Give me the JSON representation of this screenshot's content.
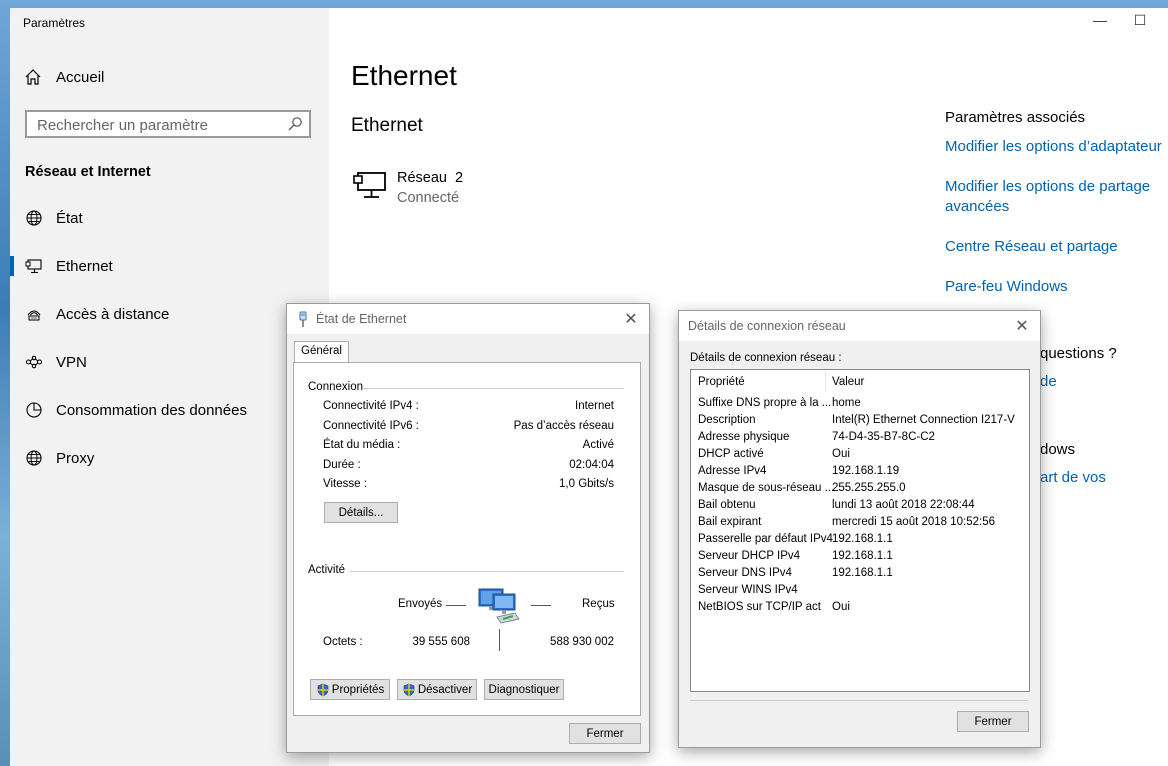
{
  "settings": {
    "window_title": "Paramètres",
    "minimize": "—",
    "maximize": "☐",
    "home_label": "Accueil",
    "search_placeholder": "Rechercher un paramètre",
    "section": "Réseau et Internet",
    "nav": [
      {
        "label": "État",
        "icon": "globe-icon"
      },
      {
        "label": "Ethernet",
        "icon": "ethernet-icon"
      },
      {
        "label": "Accès à distance",
        "icon": "dialup-icon"
      },
      {
        "label": "VPN",
        "icon": "vpn-icon"
      },
      {
        "label": "Consommation des données",
        "icon": "data-usage-icon"
      },
      {
        "label": "Proxy",
        "icon": "globe-icon"
      }
    ],
    "page_title": "Ethernet",
    "sub_title": "Ethernet",
    "network_name": "Réseau  2",
    "network_status": "Connecté",
    "related_title": "Paramètres associés",
    "related_links": [
      "Modifier les options d’adaptateur",
      "Modifier les options de partage avancées",
      "Centre Réseau et partage",
      "Pare-feu Windows"
    ],
    "peek_questions": "questions ?",
    "peek_de": "de",
    "peek_dows": "dows",
    "peek_art": "art de vos",
    "accent": "#0063b1"
  },
  "etat": {
    "title": "État de Ethernet",
    "tab": "Général",
    "connexion_label": "Connexion",
    "rows": [
      {
        "key": "Connectivité IPv4 :",
        "value": "Internet"
      },
      {
        "key": "Connectivité IPv6 :",
        "value": "Pas d’accès réseau"
      },
      {
        "key": "État du média :",
        "value": "Activé"
      },
      {
        "key": "Durée :",
        "value": "02:04:04"
      },
      {
        "key": "Vitesse :",
        "value": "1,0 Gbits/s"
      }
    ],
    "details_button": "Détails...",
    "activite_label": "Activité",
    "envoyes": "Envoyés",
    "recus": "Reçus",
    "octets_label": "Octets :",
    "octets_sent": "39 555 608",
    "octets_recv": "588 930 002",
    "btn_proprietes": "Propriétés",
    "btn_desactiver": "Désactiver",
    "btn_diagnostiquer": "Diagnostiquer",
    "btn_fermer": "Fermer"
  },
  "details": {
    "title": "Détails de connexion réseau",
    "label": "Détails de connexion réseau :",
    "col_prop": "Propriété",
    "col_val": "Valeur",
    "rows": [
      {
        "prop": "Suffixe DNS propre à la ...",
        "val": "home"
      },
      {
        "prop": "Description",
        "val": "Intel(R) Ethernet Connection I217-V"
      },
      {
        "prop": "Adresse physique",
        "val": "74-D4-35-B7-8C-C2"
      },
      {
        "prop": "DHCP activé",
        "val": "Oui"
      },
      {
        "prop": "Adresse IPv4",
        "val": "192.168.1.19"
      },
      {
        "prop": "Masque de sous-réseau ...",
        "val": "255.255.255.0"
      },
      {
        "prop": "Bail obtenu",
        "val": "lundi 13 août 2018 22:08:44"
      },
      {
        "prop": "Bail expirant",
        "val": "mercredi 15 août 2018 10:52:56"
      },
      {
        "prop": "Passerelle par défaut IPv4",
        "val": "192.168.1.1"
      },
      {
        "prop": "Serveur DHCP IPv4",
        "val": "192.168.1.1"
      },
      {
        "prop": "Serveur DNS IPv4",
        "val": "192.168.1.1"
      },
      {
        "prop": "Serveur WINS IPv4",
        "val": ""
      },
      {
        "prop": "NetBIOS sur TCP/IP act",
        "val": "Oui"
      }
    ],
    "btn_fermer": "Fermer"
  }
}
